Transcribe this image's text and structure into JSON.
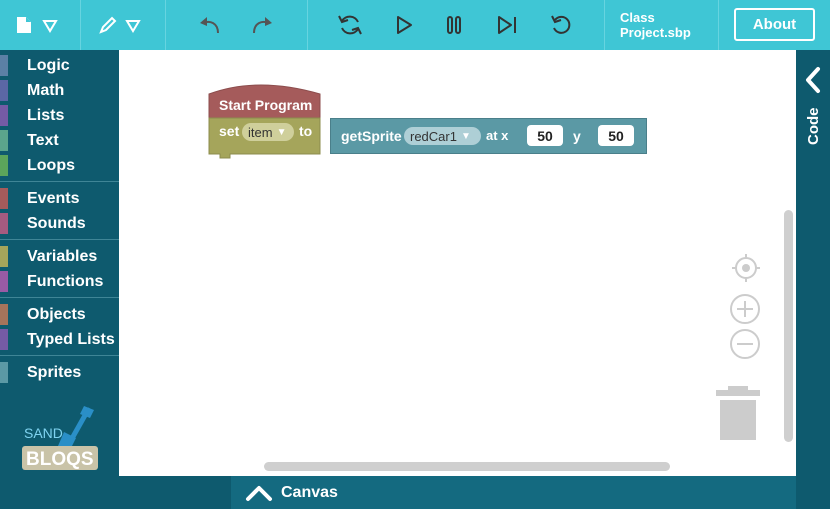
{
  "toolbar": {
    "file_icon": "file-icon",
    "edit_icon": "pencil-icon",
    "undo_icon": "undo-icon",
    "redo_icon": "redo-icon",
    "reload_icon": "reload-icon",
    "play_icon": "play-icon",
    "pause_icon": "pause-icon",
    "step_icon": "step-icon",
    "reset_icon": "reset-icon",
    "project_name": "Class Project.sbp",
    "about_label": "About"
  },
  "sidebar": {
    "categories": [
      {
        "label": "Logic",
        "color": "#5b80a5"
      },
      {
        "label": "Math",
        "color": "#5b67a5"
      },
      {
        "label": "Lists",
        "color": "#745ba5"
      },
      {
        "label": "Text",
        "color": "#5ba58c"
      },
      {
        "label": "Loops",
        "color": "#5ba55b"
      },
      {
        "label": "Events",
        "color": "#a55b5b"
      },
      {
        "label": "Sounds",
        "color": "#a55b80"
      },
      {
        "label": "Variables",
        "color": "#a5a55b"
      },
      {
        "label": "Functions",
        "color": "#995ba5"
      },
      {
        "label": "Objects",
        "color": "#a5745b"
      },
      {
        "label": "Typed Lists",
        "color": "#745ba5"
      },
      {
        "label": "Sprites",
        "color": "#5b99a5"
      }
    ],
    "logo_text_top": "SAND",
    "logo_text_bottom": "BLOQS"
  },
  "blocks": {
    "hat_label": "Start Program",
    "set_label": "set",
    "var_name": "item",
    "to_label": "to",
    "get_sprite_label": "getSprite",
    "sprite_name": "redCar1",
    "at_x_label": "at x",
    "x_value": "50",
    "y_label": "y",
    "y_value": "50",
    "colors": {
      "hat": "#a55b5b",
      "set": "#a5a55b",
      "sprite": "#5b99a5"
    }
  },
  "code_panel": {
    "label": "Code"
  },
  "bottom": {
    "canvas_label": "Canvas"
  }
}
